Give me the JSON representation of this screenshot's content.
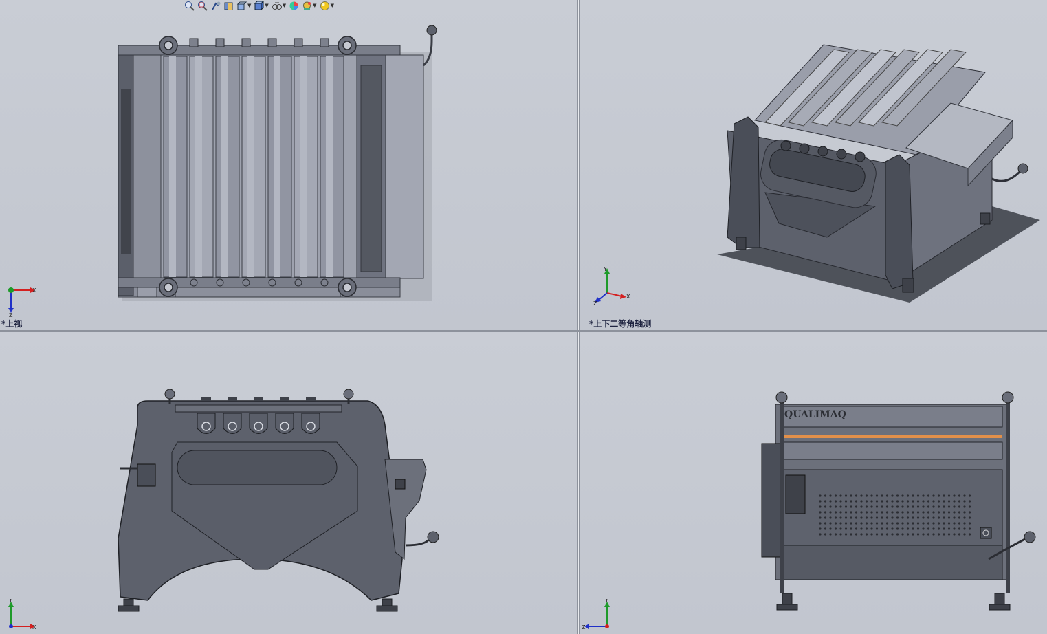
{
  "toolbar": {
    "buttons": [
      {
        "name": "zoom-to-fit-icon"
      },
      {
        "name": "zoom-to-area-icon"
      },
      {
        "name": "previous-view-icon"
      },
      {
        "name": "section-view-icon"
      },
      {
        "name": "view-orientation-icon",
        "dropdown": true
      },
      {
        "name": "display-style-icon",
        "dropdown": true
      },
      {
        "name": "hide-show-items-icon",
        "dropdown": true
      },
      {
        "name": "edit-appearance-icon"
      },
      {
        "name": "apply-scene-icon",
        "dropdown": true
      },
      {
        "name": "view-settings-icon",
        "dropdown": true
      }
    ]
  },
  "viewports": {
    "top_left": {
      "label": "*上视"
    },
    "top_right": {
      "label": "*上下二等角轴测"
    },
    "bottom_left": {
      "label": ""
    },
    "bottom_right": {
      "label": ""
    }
  },
  "triad_axes": {
    "x": "X",
    "y": "Y",
    "z": "Z"
  },
  "model": {
    "brand": "QUALIMAQ"
  },
  "colors": {
    "background": "#c5c9d1",
    "model_body": "#5d616c",
    "model_light": "#8b8f9c",
    "axis_x": "#d42020",
    "axis_y": "#1e9a2a",
    "axis_z": "#2030c8",
    "accent_orange": "#e2904a"
  }
}
